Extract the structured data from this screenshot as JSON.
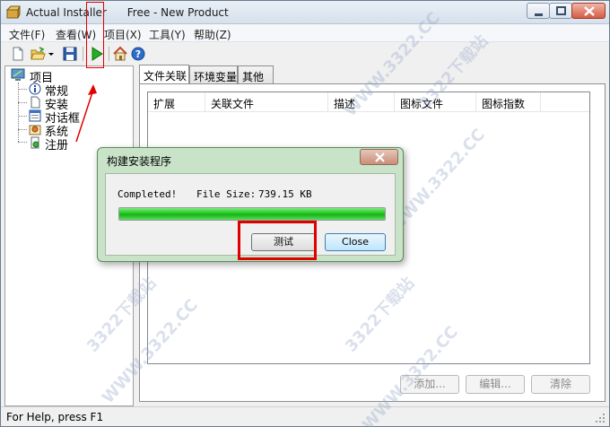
{
  "window": {
    "app_name": "Actual Installer",
    "subtitle": "Free - New Product",
    "icons": {
      "app": "installer-box-icon",
      "minimize": "minimize-icon",
      "maximize": "maximize-icon",
      "close": "close-icon"
    }
  },
  "menu": [
    {
      "label": "文件(F)"
    },
    {
      "label": "查看(W)"
    },
    {
      "label": "项目(X)"
    },
    {
      "label": "工具(Y)"
    },
    {
      "label": "帮助(Z)"
    }
  ],
  "toolbar": {
    "icons": [
      "new-file-icon",
      "open-folder-icon",
      "dropdown-arrow-icon",
      "save-disk-icon",
      "run-build-icon",
      "home-icon",
      "help-icon"
    ]
  },
  "tree": {
    "root": "项目",
    "items": [
      {
        "label": "常规",
        "icon": "info-icon"
      },
      {
        "label": "安装",
        "icon": "document-icon"
      },
      {
        "label": "对话框",
        "icon": "dialog-window-icon"
      },
      {
        "label": "系统",
        "icon": "system-icon"
      },
      {
        "label": "注册",
        "icon": "registry-icon"
      }
    ]
  },
  "tabs": [
    {
      "label": "文件关联",
      "active": true
    },
    {
      "label": "环境变量",
      "active": false
    },
    {
      "label": "其他",
      "active": false
    }
  ],
  "table": {
    "columns": [
      "扩展",
      "关联文件",
      "描述",
      "图标文件",
      "图标指数"
    ],
    "rows": []
  },
  "actions": {
    "add": "添加...",
    "edit": "编辑...",
    "delete": "清除"
  },
  "status": {
    "text": "For Help, press F1"
  },
  "dialog": {
    "title": "构建安装程序",
    "status": "Completed!",
    "size_label": "File Size:",
    "size_value": "739.15 KB",
    "progress": 1.0,
    "test_button": "测试",
    "close_button": "Close"
  },
  "watermark": "WWW.3322.CC",
  "watermark_alt": "3322下载站",
  "colors": {
    "progress": "#18c318",
    "highlight": "#e00000",
    "dialog_frame": "#c9e3c9"
  }
}
